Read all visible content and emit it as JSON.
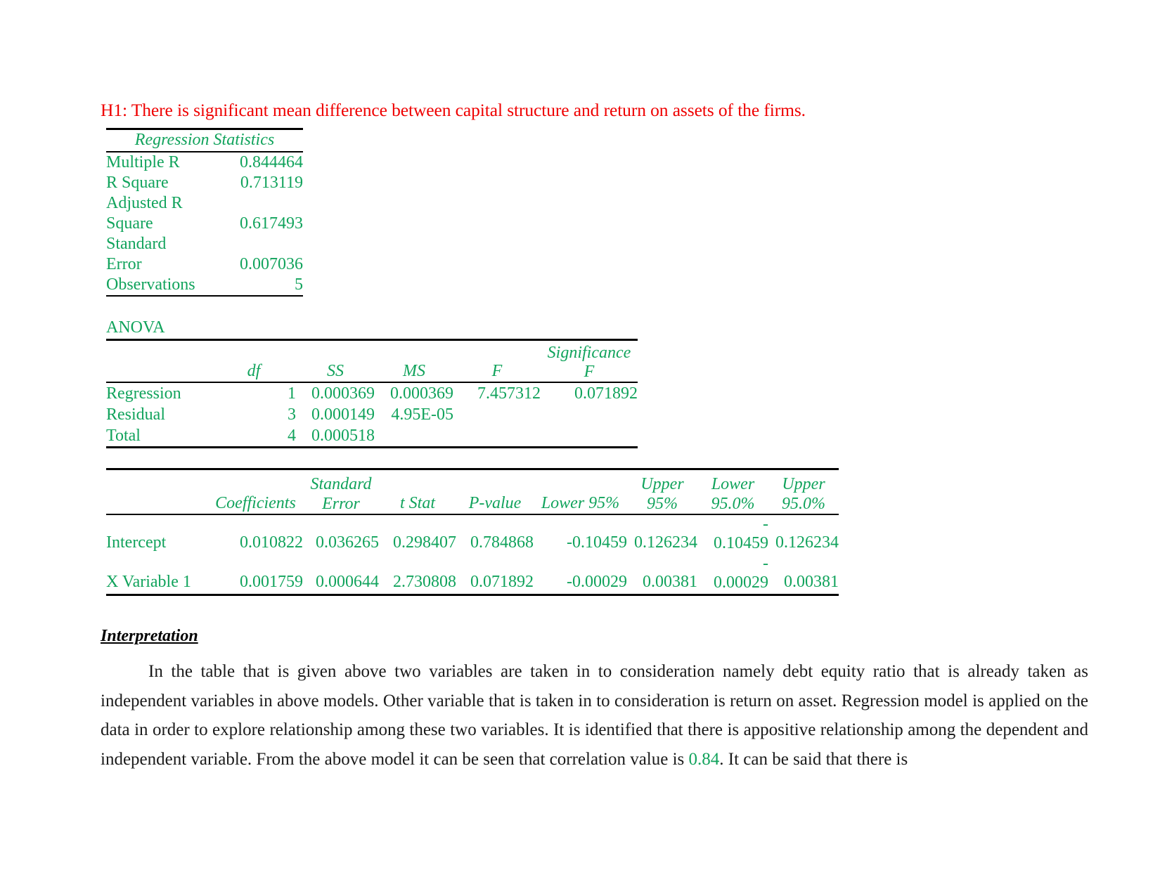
{
  "document": {
    "hypothesis": "H1: There is significant mean difference between capital structure and return on assets of the firms.",
    "colors": {
      "hypothesis_red": "#ef0000",
      "table_green": "#11a35c",
      "body_black": "#1a1a1a"
    }
  },
  "regression_statistics": {
    "title": "Regression Statistics",
    "rows": [
      {
        "label": "Multiple R",
        "value": "0.844464"
      },
      {
        "label": "R Square",
        "value": "0.713119"
      },
      {
        "label": "Adjusted R",
        "label2": "Square",
        "value": "0.617493"
      },
      {
        "label": "Standard",
        "label2": "Error",
        "value": "0.007036"
      },
      {
        "label": "Observations",
        "value": "5"
      }
    ]
  },
  "anova": {
    "title": "ANOVA",
    "headers": {
      "blank": "",
      "df": "df",
      "ss": "SS",
      "ms": "MS",
      "f": "F",
      "sig_f_line1": "Significance",
      "sig_f_line2": "F"
    },
    "rows": [
      {
        "name": "Regression",
        "df": "1",
        "ss": "0.000369",
        "ms": "0.000369",
        "f": "7.457312",
        "sig_f": "0.071892"
      },
      {
        "name": "Residual",
        "df": "3",
        "ss": "0.000149",
        "ms": "4.95E-05",
        "f": "",
        "sig_f": ""
      },
      {
        "name": "Total",
        "df": "4",
        "ss": "0.000518",
        "ms": "",
        "f": "",
        "sig_f": ""
      }
    ]
  },
  "coefficients": {
    "headers": {
      "blank": "",
      "coefficients": "Coefficients",
      "se_line1": "Standard",
      "se_line2": "Error",
      "t_stat": "t Stat",
      "p_value": "P-value",
      "lower95": "Lower 95%",
      "upper95_line1": "Upper",
      "upper95_line2": "95%",
      "lower950_line1": "Lower",
      "lower950_line2": "95.0%",
      "upper950_line1": "Upper",
      "upper950_line2": "95.0%"
    },
    "rows": [
      {
        "name": "Intercept",
        "coefficients": "0.010822",
        "standard_error": "0.036265",
        "t_stat": "0.298407",
        "p_value": "0.784868",
        "lower95": "-0.10459",
        "upper95": "0.126234",
        "lower950_sign": "-",
        "lower950": "0.10459",
        "upper950": "0.126234"
      },
      {
        "name": "X Variable 1",
        "coefficients": "0.001759",
        "standard_error": "0.000644",
        "t_stat": "2.730808",
        "p_value": "0.071892",
        "lower95": "-0.00029",
        "upper95": "0.00381",
        "lower950_sign": "-",
        "lower950": "0.00029",
        "upper950": "0.00381"
      }
    ]
  },
  "interpretation": {
    "heading": "Interpretation",
    "paragraph_part1": "In the table that is given above two variables are taken in to consideration namely debt equity ratio that is already taken as independent variables in above models. Other variable that is taken in to consideration is return on asset. Regression model is applied on the data in order to explore relationship among these two variables. It is identified that there is appositive relationship among the dependent and independent variable. From the above model it can be seen that correlation value is ",
    "highlight_value": "0.84",
    "paragraph_part2": ". It can be said that there is"
  }
}
